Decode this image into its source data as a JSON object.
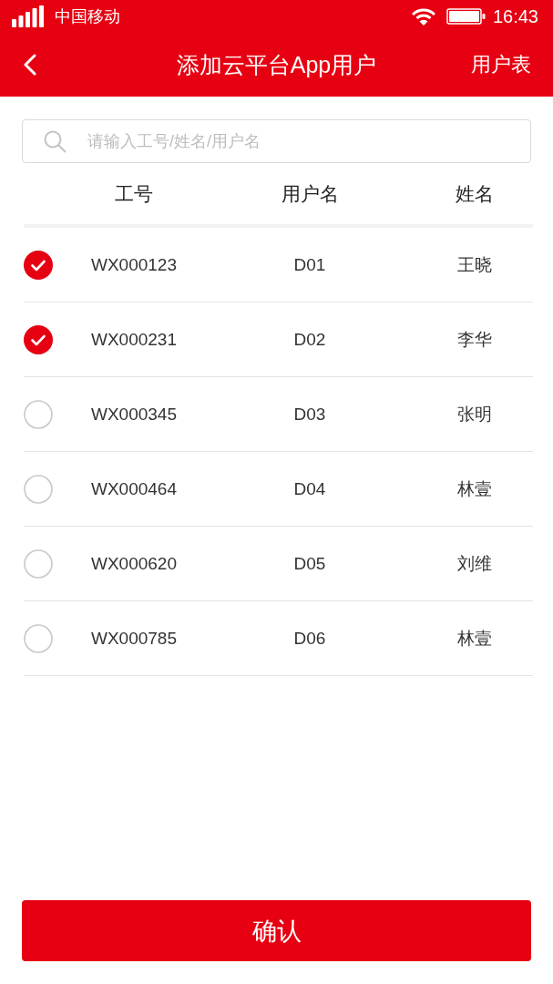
{
  "status_bar": {
    "carrier": "中国移动",
    "time": "16:43"
  },
  "header": {
    "title": "添加云平台App用户",
    "action": "用户表"
  },
  "search": {
    "placeholder": "请输入工号/姓名/用户名"
  },
  "table": {
    "columns": [
      "工号",
      "用户名",
      "姓名"
    ],
    "rows": [
      {
        "id": "WX000123",
        "username": "D01",
        "name": "王晓",
        "selected": true
      },
      {
        "id": "WX000231",
        "username": "D02",
        "name": "李华",
        "selected": true
      },
      {
        "id": "WX000345",
        "username": "D03",
        "name": "张明",
        "selected": false
      },
      {
        "id": "WX000464",
        "username": "D04",
        "name": "林壹",
        "selected": false
      },
      {
        "id": "WX000620",
        "username": "D05",
        "name": "刘维",
        "selected": false
      },
      {
        "id": "WX000785",
        "username": "D06",
        "name": "林壹",
        "selected": false
      }
    ]
  },
  "confirm_button": "确认"
}
